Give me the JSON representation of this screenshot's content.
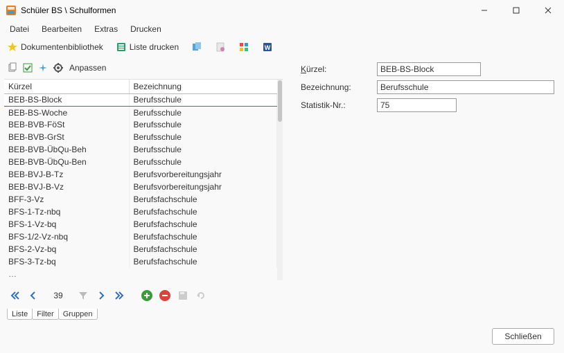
{
  "window": {
    "title": "Schüler BS \\ Schulformen"
  },
  "menubar": {
    "items": [
      "Datei",
      "Bearbeiten",
      "Extras",
      "Drucken"
    ]
  },
  "toolbar1": {
    "doclib": "Dokumentenbibliothek",
    "printlist": "Liste drucken"
  },
  "toolbar2": {
    "customize": "Anpassen"
  },
  "grid": {
    "col1": "Kürzel",
    "col2": "Bezeichnung",
    "rows": [
      {
        "k": "BEB-BS-Block",
        "b": "Berufsschule"
      },
      {
        "k": "BEB-BS-Woche",
        "b": "Berufsschule"
      },
      {
        "k": "BEB-BVB-FöSt",
        "b": "Berufsschule"
      },
      {
        "k": "BEB-BVB-GrSt",
        "b": "Berufsschule"
      },
      {
        "k": "BEB-BVB-ÜbQu-Beh",
        "b": "Berufsschule"
      },
      {
        "k": "BEB-BVB-ÜbQu-Ben",
        "b": "Berufsschule"
      },
      {
        "k": "BEB-BVJ-B-Tz",
        "b": "Berufsvorbereitungsjahr"
      },
      {
        "k": "BEB-BVJ-B-Vz",
        "b": "Berufsvorbereitungsjahr"
      },
      {
        "k": "BFF-3-Vz",
        "b": "Berufsfachschule"
      },
      {
        "k": "BFS-1-Tz-nbq",
        "b": "Berufsfachschule"
      },
      {
        "k": "BFS-1-Vz-bq",
        "b": "Berufsfachschule"
      },
      {
        "k": "BFS-1/2-Vz-nbq",
        "b": "Berufsfachschule"
      },
      {
        "k": "BFS-2-Vz-bq",
        "b": "Berufsfachschule"
      },
      {
        "k": "BFS-3-Tz-bq",
        "b": "Berufsfachschule"
      }
    ]
  },
  "nav": {
    "count": "39"
  },
  "tabs": {
    "items": [
      "Liste",
      "Filter",
      "Gruppen"
    ]
  },
  "form": {
    "kuerzel_label": "Kürzel:",
    "kuerzel_value": "BEB-BS-Block",
    "bezeichnung_label": "Bezeichnung:",
    "bezeichnung_value": "Berufsschule",
    "statistik_label": "Statistik-Nr.:",
    "statistik_value": "75"
  },
  "footer": {
    "close": "Schließen"
  }
}
